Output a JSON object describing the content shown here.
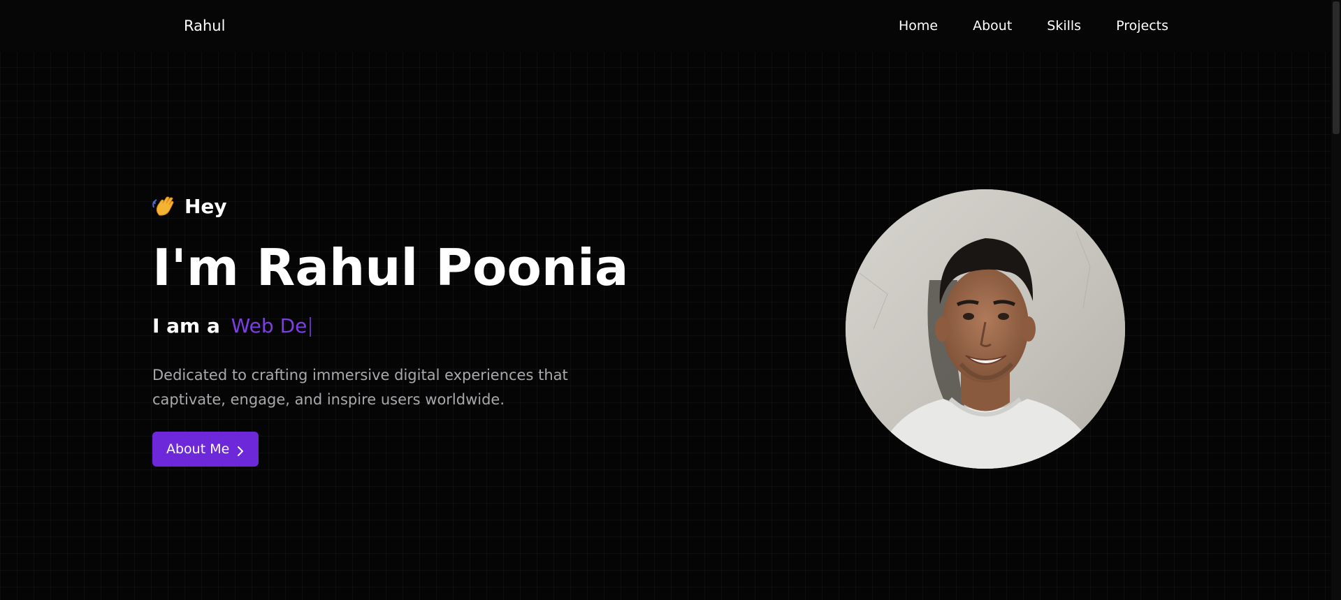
{
  "navbar": {
    "brand": "Rahul",
    "links": [
      {
        "label": "Home"
      },
      {
        "label": "About"
      },
      {
        "label": "Skills"
      },
      {
        "label": "Projects"
      }
    ]
  },
  "hero": {
    "greeting": "Hey",
    "greeting_icon": "waving-hand-icon",
    "title": "I'm Rahul Poonia",
    "role_prefix": "I am a",
    "role_typed": "Web De",
    "description": "Dedicated to crafting immersive digital experiences that captivate, engage, and inspire users worldwide.",
    "cta_label": "About Me",
    "cta_icon": "chevron-right-icon"
  },
  "avatar": {
    "icon": "profile-photo"
  },
  "colors": {
    "background": "#050505",
    "accent": "#6d28d9",
    "accent_text": "#7b3fe4",
    "muted_text": "#a9a9ad"
  }
}
